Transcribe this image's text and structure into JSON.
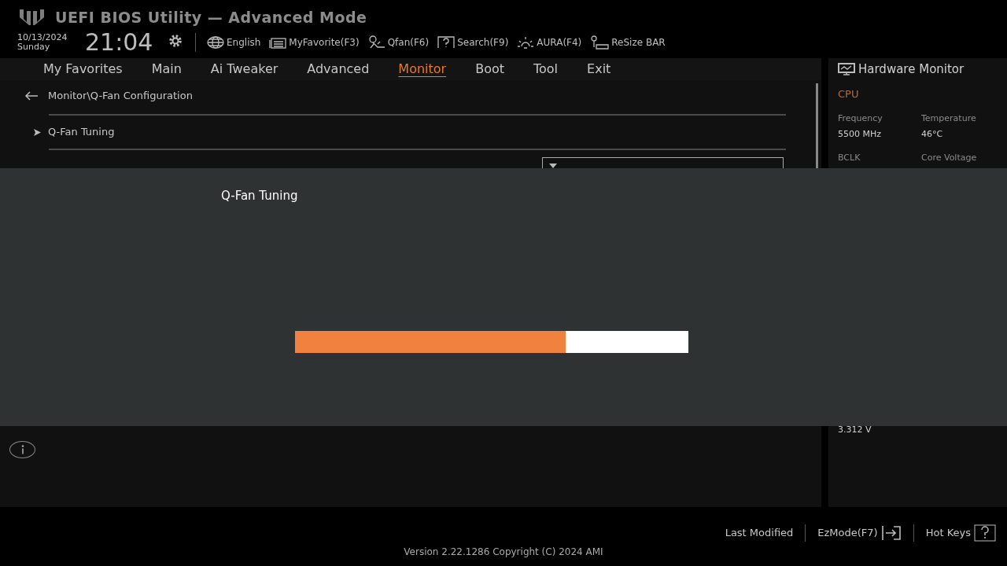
{
  "header": {
    "title": "UEFI BIOS Utility — Advanced Mode",
    "date": "10/13/2024",
    "day": "Sunday",
    "time": "21:04",
    "tools": [
      {
        "kind": "globe",
        "label": "English"
      },
      {
        "kind": "favorite",
        "label": "MyFavorite(F3)"
      },
      {
        "kind": "fan",
        "label": "Qfan(F6)"
      },
      {
        "kind": "search",
        "label": "Search(F9)"
      },
      {
        "kind": "aura",
        "label": "AURA(F4)"
      },
      {
        "kind": "resize",
        "label": "ReSize BAR"
      }
    ]
  },
  "tabs": [
    {
      "label": "My Favorites",
      "selected": false
    },
    {
      "label": "Main",
      "selected": false
    },
    {
      "label": "Ai Tweaker",
      "selected": false
    },
    {
      "label": "Advanced",
      "selected": false
    },
    {
      "label": "Monitor",
      "selected": true
    },
    {
      "label": "Boot",
      "selected": false
    },
    {
      "label": "Tool",
      "selected": false
    },
    {
      "label": "Exit",
      "selected": false
    }
  ],
  "breadcrumb": "Monitor\\Q-Fan Configuration",
  "items": [
    {
      "kind": "submenu",
      "label": "Q-Fan Tuning"
    },
    {
      "kind": "dropdown"
    }
  ],
  "hardware_monitor": {
    "title": "Hardware Monitor",
    "section": "CPU",
    "readings": [
      {
        "label": "Frequency",
        "value": "5500 MHz"
      },
      {
        "label": "Temperature",
        "value": "46°C"
      },
      {
        "label": "BCLK"
      },
      {
        "label": "Core Voltage"
      }
    ],
    "extra_value": "3.312 V"
  },
  "dialog": {
    "title": "Q-Fan Tuning",
    "level": 0.688
  },
  "footer": {
    "buttons": [
      {
        "kind": "plain",
        "label": "Last Modified"
      },
      {
        "kind": "ezmode",
        "label": "EzMode(F7)"
      },
      {
        "kind": "hotkeys",
        "label": "Hot Keys"
      }
    ],
    "version": "Version 2.22.1286 Copyright (C) 2024 AMI"
  }
}
